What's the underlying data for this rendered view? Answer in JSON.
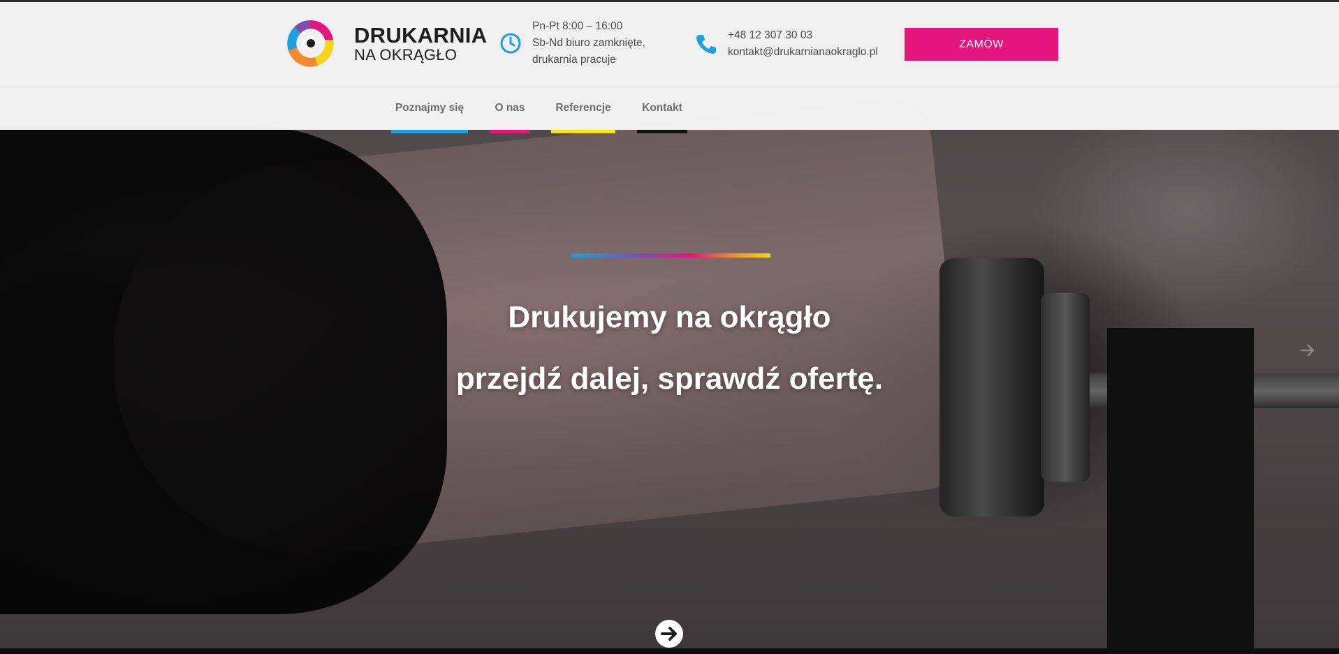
{
  "brand": {
    "name_line1": "DRUKARNIA",
    "name_line2": "NA OKRĄGŁO",
    "logo_icon": "circular-cmyk-swirl-logo"
  },
  "header": {
    "hours": {
      "icon": "clock-icon",
      "line1": "Pn-Pt 8:00 – 16:00",
      "line2": "Sb-Nd biuro zamknięte,",
      "line3": "drukarnia pracuje"
    },
    "contact": {
      "icon": "phone-icon",
      "phone": "+48 12 307 30 03",
      "email": "kontakt@drukarnianaokraglo.pl"
    },
    "order_button": "ZAMÓW"
  },
  "nav": {
    "items": [
      {
        "label": "Poznajmy się",
        "accent": "#1ea0dc"
      },
      {
        "label": "O nas",
        "accent": "#e5157e"
      },
      {
        "label": "Referencje",
        "accent": "#f7e11a"
      },
      {
        "label": "Kontakt",
        "accent": "#111111"
      }
    ]
  },
  "hero": {
    "line1": "Drukujemy na okrągło",
    "line2": "przejdź dalej, sprawdź ofertę.",
    "next_icon": "arrow-right-icon",
    "scroll_icon": "circle-arrow-right-icon"
  },
  "colors": {
    "accent_pink": "#e5157e",
    "accent_cyan": "#1ea0dc",
    "accent_yellow": "#f7e11a",
    "accent_black": "#111111"
  }
}
